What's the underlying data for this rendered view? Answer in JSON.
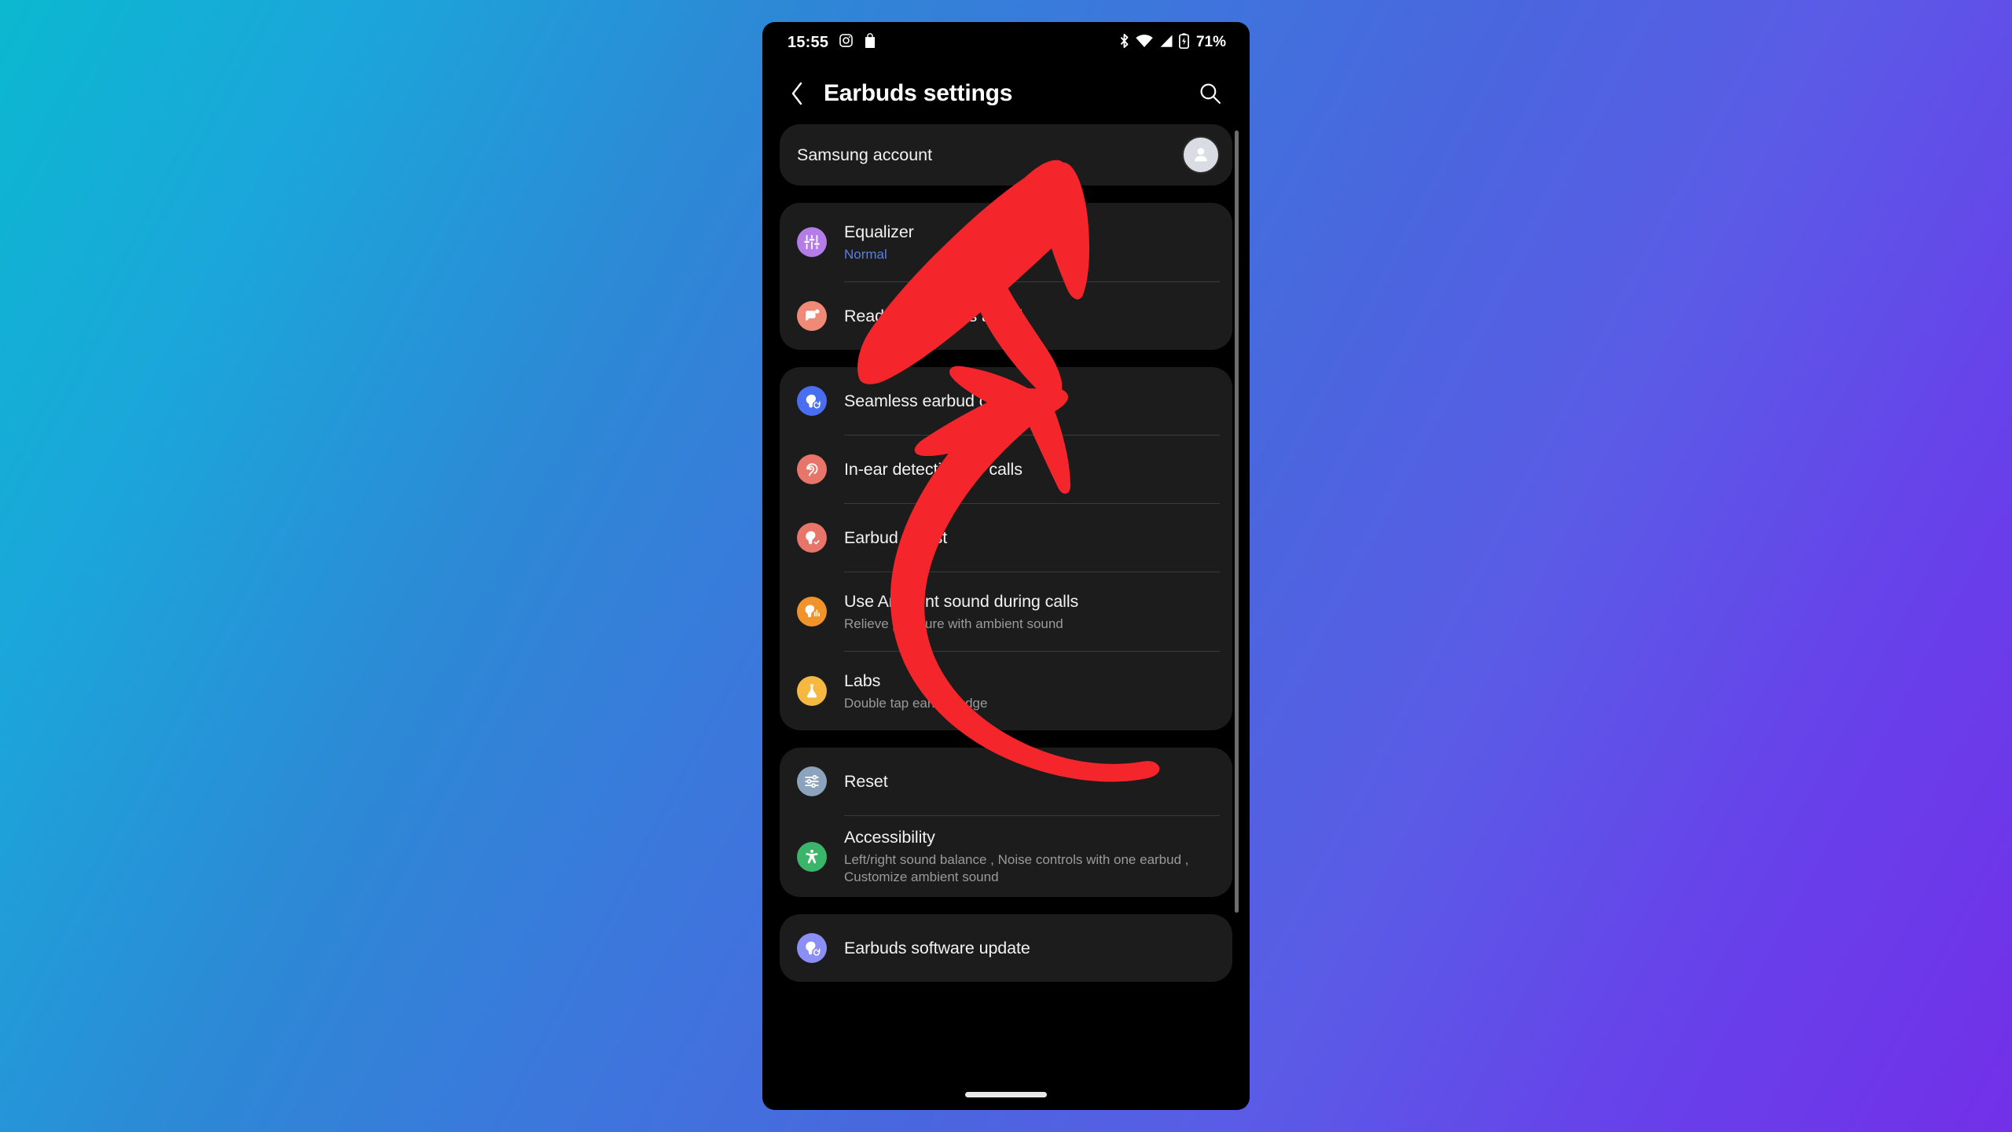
{
  "background": {
    "gradient_from": "#0bb8d0",
    "gradient_mid": "#4a66de",
    "gradient_to": "#7230e8"
  },
  "statusbar": {
    "time": "15:55",
    "battery_percent": "71%",
    "icons": [
      "instagram-icon",
      "shopping-bag-icon",
      "bluetooth-icon",
      "wifi-icon",
      "signal-icon",
      "battery-icon"
    ]
  },
  "header": {
    "back_label": "Back",
    "title": "Earbuds settings",
    "search_label": "Search"
  },
  "account": {
    "label": "Samsung account",
    "avatar_name": "person-avatar"
  },
  "annotation": {
    "arrow_color": "#f5262b",
    "arrow_name": "red-curved-arrow-annotation",
    "points_at": "Seamless earbud connection"
  },
  "sections": [
    {
      "id": "sound-section",
      "rows": [
        {
          "id": "equalizer",
          "title": "Equalizer",
          "subtitle": "Normal",
          "subtitle_accent": true,
          "icon": "equalizer-sliders-icon",
          "icon_bg": "#b47ce6"
        },
        {
          "id": "read-notifications-aloud",
          "title": "Read notifications aloud",
          "subtitle": "",
          "subtitle_accent": false,
          "icon": "speech-bubble-notification-icon",
          "icon_bg": "#f08a78"
        }
      ]
    },
    {
      "id": "connection-section",
      "rows": [
        {
          "id": "seamless-earbud-connection",
          "title": "Seamless earbud connection",
          "subtitle": "",
          "subtitle_accent": false,
          "icon": "earbud-sync-icon",
          "icon_bg": "#4a6ef0"
        },
        {
          "id": "in-ear-detection-for-calls",
          "title": "In-ear detection for calls",
          "subtitle": "",
          "subtitle_accent": false,
          "icon": "ear-detection-icon",
          "icon_bg": "#e8756a"
        },
        {
          "id": "earbud-fit-test",
          "title": "Earbud fit test",
          "subtitle": "",
          "subtitle_accent": false,
          "icon": "earbud-check-icon",
          "icon_bg": "#e8756a"
        },
        {
          "id": "use-ambient-sound-during-calls",
          "title": "Use Ambient sound during calls",
          "subtitle": "Relieve pressure with ambient sound",
          "subtitle_accent": false,
          "icon": "ambient-sound-waves-icon",
          "icon_bg": "#f0932b"
        },
        {
          "id": "labs",
          "title": "Labs",
          "subtitle": "Double tap earbud edge",
          "subtitle_accent": false,
          "icon": "lab-flask-icon",
          "icon_bg": "#f5b942"
        }
      ]
    },
    {
      "id": "system-section",
      "rows": [
        {
          "id": "reset",
          "title": "Reset",
          "subtitle": "",
          "subtitle_accent": false,
          "icon": "reset-sliders-icon",
          "icon_bg": "#8ba3bd"
        },
        {
          "id": "accessibility",
          "title": "Accessibility",
          "subtitle": "Left/right sound balance , Noise controls with one earbud , Customize ambient sound",
          "subtitle_accent": false,
          "icon": "accessibility-person-icon",
          "icon_bg": "#3bb56a"
        }
      ]
    },
    {
      "id": "update-section",
      "rows": [
        {
          "id": "earbuds-software-update",
          "title": "Earbuds software update",
          "subtitle": "",
          "subtitle_accent": false,
          "icon": "earbud-update-icon",
          "icon_bg": "#8a8ef5"
        }
      ]
    }
  ]
}
